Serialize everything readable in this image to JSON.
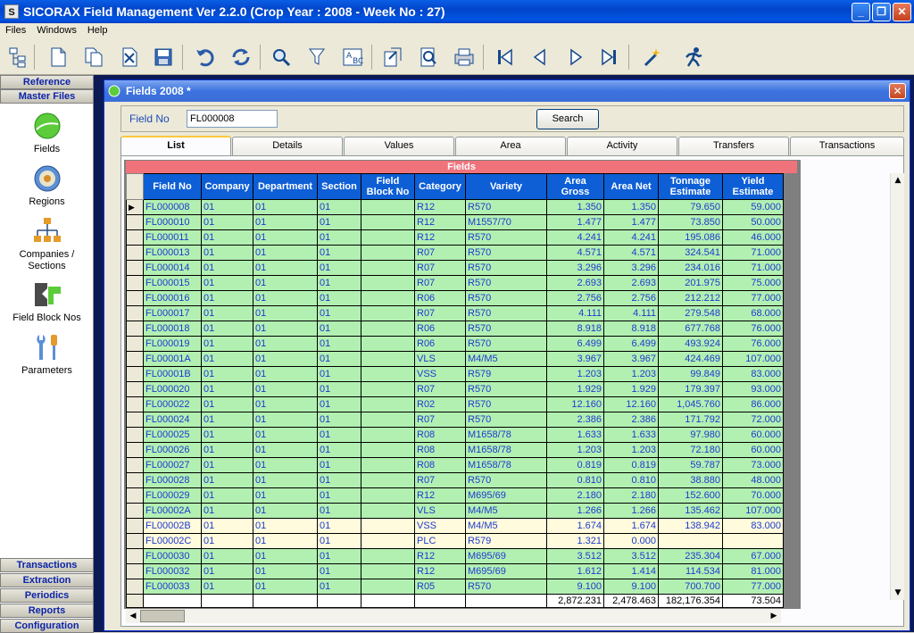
{
  "app": {
    "title": "SICORAX Field Management Ver 2.2.0 (Crop Year : 2008 - Week No : 27)",
    "icon_letter": "S"
  },
  "window_controls": {
    "minimize": "_",
    "maximize": "❐",
    "close": "✕"
  },
  "menu": [
    "Files",
    "Windows",
    "Help"
  ],
  "toolbar_icons": [
    "tree-icon",
    "new-document-icon",
    "copy-icon",
    "delete-icon",
    "save-icon",
    "undo-icon",
    "refresh-icon",
    "search-icon",
    "filter-icon",
    "sort-icon",
    "export-icon",
    "preview-icon",
    "print-icon",
    "first-record-icon",
    "previous-record-icon",
    "next-record-icon",
    "last-record-icon",
    "wizard-icon",
    "exit-icon"
  ],
  "sidebar": {
    "top_headers": [
      "Reference",
      "Master Files"
    ],
    "items": [
      {
        "label": "Fields",
        "icon": "fields-icon"
      },
      {
        "label": "Regions",
        "icon": "regions-icon"
      },
      {
        "label": "Companies / Sections",
        "icon": "companies-icon"
      },
      {
        "label": "Field Block Nos",
        "icon": "field-block-icon"
      },
      {
        "label": "Parameters",
        "icon": "parameters-icon"
      }
    ],
    "bottom_headers": [
      "Transactions",
      "Extraction",
      "Periodics",
      "Reports",
      "Configuration"
    ]
  },
  "child_window": {
    "title": "Fields 2008 *",
    "close": "✕"
  },
  "search": {
    "label": "Field No",
    "value": "FL000008",
    "button": "Search"
  },
  "tabs": [
    {
      "label": "List",
      "active": true
    },
    {
      "label": "Details",
      "active": false
    },
    {
      "label": "Values",
      "active": false
    },
    {
      "label": "Area",
      "active": false
    },
    {
      "label": "Activity",
      "active": false
    },
    {
      "label": "Transfers",
      "active": false
    },
    {
      "label": "Transactions",
      "active": false
    }
  ],
  "grid": {
    "caption": "Fields",
    "columns": [
      "Field No",
      "Company",
      "Department",
      "Section",
      "Field\nBlock No",
      "Category",
      "Variety",
      "Area\nGross",
      "Area Net",
      "Tonnage\nEstimate",
      "Yield\nEstimate"
    ],
    "rows": [
      {
        "field_no": "FL000008",
        "company": "01",
        "department": "01",
        "section": "01",
        "block": "",
        "category": "R12",
        "variety": "R570",
        "area_gross": "1.350",
        "area_net": "1.350",
        "tonnage": "79.650",
        "yield": "59.000",
        "color": "green",
        "current": true
      },
      {
        "field_no": "FL000010",
        "company": "01",
        "department": "01",
        "section": "01",
        "block": "",
        "category": "R12",
        "variety": "M1557/70",
        "area_gross": "1.477",
        "area_net": "1.477",
        "tonnage": "73.850",
        "yield": "50.000",
        "color": "green"
      },
      {
        "field_no": "FL000011",
        "company": "01",
        "department": "01",
        "section": "01",
        "block": "",
        "category": "R12",
        "variety": "R570",
        "area_gross": "4.241",
        "area_net": "4.241",
        "tonnage": "195.086",
        "yield": "46.000",
        "color": "green"
      },
      {
        "field_no": "FL000013",
        "company": "01",
        "department": "01",
        "section": "01",
        "block": "",
        "category": "R07",
        "variety": "R570",
        "area_gross": "4.571",
        "area_net": "4.571",
        "tonnage": "324.541",
        "yield": "71.000",
        "color": "green"
      },
      {
        "field_no": "FL000014",
        "company": "01",
        "department": "01",
        "section": "01",
        "block": "",
        "category": "R07",
        "variety": "R570",
        "area_gross": "3.296",
        "area_net": "3.296",
        "tonnage": "234.016",
        "yield": "71.000",
        "color": "green"
      },
      {
        "field_no": "FL000015",
        "company": "01",
        "department": "01",
        "section": "01",
        "block": "",
        "category": "R07",
        "variety": "R570",
        "area_gross": "2.693",
        "area_net": "2.693",
        "tonnage": "201.975",
        "yield": "75.000",
        "color": "green"
      },
      {
        "field_no": "FL000016",
        "company": "01",
        "department": "01",
        "section": "01",
        "block": "",
        "category": "R06",
        "variety": "R570",
        "area_gross": "2.756",
        "area_net": "2.756",
        "tonnage": "212.212",
        "yield": "77.000",
        "color": "green"
      },
      {
        "field_no": "FL000017",
        "company": "01",
        "department": "01",
        "section": "01",
        "block": "",
        "category": "R07",
        "variety": "R570",
        "area_gross": "4.111",
        "area_net": "4.111",
        "tonnage": "279.548",
        "yield": "68.000",
        "color": "green"
      },
      {
        "field_no": "FL000018",
        "company": "01",
        "department": "01",
        "section": "01",
        "block": "",
        "category": "R06",
        "variety": "R570",
        "area_gross": "8.918",
        "area_net": "8.918",
        "tonnage": "677.768",
        "yield": "76.000",
        "color": "green"
      },
      {
        "field_no": "FL000019",
        "company": "01",
        "department": "01",
        "section": "01",
        "block": "",
        "category": "R06",
        "variety": "R570",
        "area_gross": "6.499",
        "area_net": "6.499",
        "tonnage": "493.924",
        "yield": "76.000",
        "color": "green"
      },
      {
        "field_no": "FL00001A",
        "company": "01",
        "department": "01",
        "section": "01",
        "block": "",
        "category": "VLS",
        "variety": "M4/M5",
        "area_gross": "3.967",
        "area_net": "3.967",
        "tonnage": "424.469",
        "yield": "107.000",
        "color": "green"
      },
      {
        "field_no": "FL00001B",
        "company": "01",
        "department": "01",
        "section": "01",
        "block": "",
        "category": "VSS",
        "variety": "R579",
        "area_gross": "1.203",
        "area_net": "1.203",
        "tonnage": "99.849",
        "yield": "83.000",
        "color": "green"
      },
      {
        "field_no": "FL000020",
        "company": "01",
        "department": "01",
        "section": "01",
        "block": "",
        "category": "R07",
        "variety": "R570",
        "area_gross": "1.929",
        "area_net": "1.929",
        "tonnage": "179.397",
        "yield": "93.000",
        "color": "green"
      },
      {
        "field_no": "FL000022",
        "company": "01",
        "department": "01",
        "section": "01",
        "block": "",
        "category": "R02",
        "variety": "R570",
        "area_gross": "12.160",
        "area_net": "12.160",
        "tonnage": "1,045.760",
        "yield": "86.000",
        "color": "green"
      },
      {
        "field_no": "FL000024",
        "company": "01",
        "department": "01",
        "section": "01",
        "block": "",
        "category": "R07",
        "variety": "R570",
        "area_gross": "2.386",
        "area_net": "2.386",
        "tonnage": "171.792",
        "yield": "72.000",
        "color": "green"
      },
      {
        "field_no": "FL000025",
        "company": "01",
        "department": "01",
        "section": "01",
        "block": "",
        "category": "R08",
        "variety": "M1658/78",
        "area_gross": "1.633",
        "area_net": "1.633",
        "tonnage": "97.980",
        "yield": "60.000",
        "color": "green"
      },
      {
        "field_no": "FL000026",
        "company": "01",
        "department": "01",
        "section": "01",
        "block": "",
        "category": "R08",
        "variety": "M1658/78",
        "area_gross": "1.203",
        "area_net": "1.203",
        "tonnage": "72.180",
        "yield": "60.000",
        "color": "green"
      },
      {
        "field_no": "FL000027",
        "company": "01",
        "department": "01",
        "section": "01",
        "block": "",
        "category": "R08",
        "variety": "M1658/78",
        "area_gross": "0.819",
        "area_net": "0.819",
        "tonnage": "59.787",
        "yield": "73.000",
        "color": "green"
      },
      {
        "field_no": "FL000028",
        "company": "01",
        "department": "01",
        "section": "01",
        "block": "",
        "category": "R07",
        "variety": "R570",
        "area_gross": "0.810",
        "area_net": "0.810",
        "tonnage": "38.880",
        "yield": "48.000",
        "color": "green"
      },
      {
        "field_no": "FL000029",
        "company": "01",
        "department": "01",
        "section": "01",
        "block": "",
        "category": "R12",
        "variety": "M695/69",
        "area_gross": "2.180",
        "area_net": "2.180",
        "tonnage": "152.600",
        "yield": "70.000",
        "color": "green"
      },
      {
        "field_no": "FL00002A",
        "company": "01",
        "department": "01",
        "section": "01",
        "block": "",
        "category": "VLS",
        "variety": "M4/M5",
        "area_gross": "1.266",
        "area_net": "1.266",
        "tonnage": "135.462",
        "yield": "107.000",
        "color": "green"
      },
      {
        "field_no": "FL00002B",
        "company": "01",
        "department": "01",
        "section": "01",
        "block": "",
        "category": "VSS",
        "variety": "M4/M5",
        "area_gross": "1.674",
        "area_net": "1.674",
        "tonnage": "138.942",
        "yield": "83.000",
        "color": "yellow"
      },
      {
        "field_no": "FL00002C",
        "company": "01",
        "department": "01",
        "section": "01",
        "block": "",
        "category": "PLC",
        "variety": "R579",
        "area_gross": "1.321",
        "area_net": "0.000",
        "tonnage": "",
        "yield": "",
        "color": "yellow"
      },
      {
        "field_no": "FL000030",
        "company": "01",
        "department": "01",
        "section": "01",
        "block": "",
        "category": "R12",
        "variety": "M695/69",
        "area_gross": "3.512",
        "area_net": "3.512",
        "tonnage": "235.304",
        "yield": "67.000",
        "color": "green"
      },
      {
        "field_no": "FL000032",
        "company": "01",
        "department": "01",
        "section": "01",
        "block": "",
        "category": "R12",
        "variety": "M695/69",
        "area_gross": "1.612",
        "area_net": "1.414",
        "tonnage": "114.534",
        "yield": "81.000",
        "color": "green"
      },
      {
        "field_no": "FL000033",
        "company": "01",
        "department": "01",
        "section": "01",
        "block": "",
        "category": "R05",
        "variety": "R570",
        "area_gross": "9.100",
        "area_net": "9.100",
        "tonnage": "700.700",
        "yield": "77.000",
        "color": "green"
      }
    ],
    "totals": {
      "area_gross": "2,872.231",
      "area_net": "2,478.463",
      "tonnage": "182,176.354",
      "yield": "73.504"
    },
    "current_row_marker": "▶"
  },
  "colors": {
    "header_blue": "#0e5fd6",
    "row_green": "#b2f0b2",
    "row_yellow": "#fffbdc",
    "caption_red": "#f0737b"
  }
}
